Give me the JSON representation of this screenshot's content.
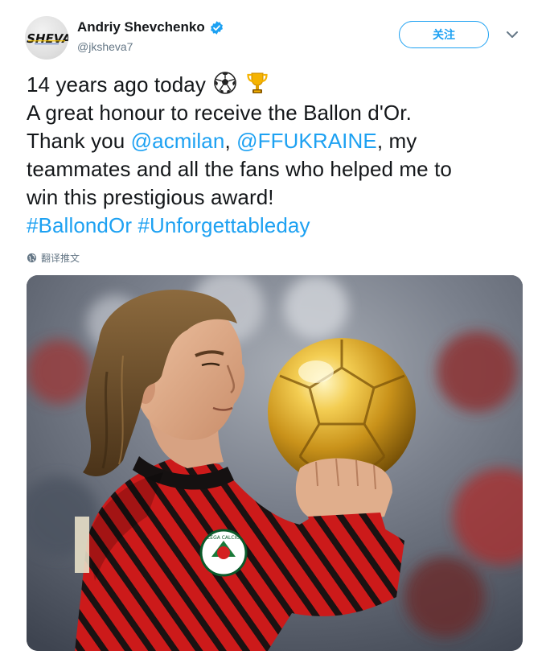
{
  "author": {
    "name": "Andriy Shevchenko",
    "handle": "@jksheva7",
    "avatar_text": "SHEVA",
    "verified_icon": "verified-badge-icon"
  },
  "actions": {
    "follow_label": "关注",
    "menu_icon": "chevron-down-icon"
  },
  "tweet": {
    "line1": "14 years ago today",
    "line2": "A great honour to receive the Ballon d'Or.",
    "line3_pre": "Thank you ",
    "mention1": "@acmilan",
    "line3_mid": ", ",
    "mention2": "@FFUKRAINE",
    "line3_post": ", my",
    "line4": "teammates and all the fans who helped me to",
    "line5": "win this prestigious award!",
    "hashtag1": "#BallondOr",
    "hashtag2": "#Unforgettableday",
    "emojis": [
      "soccer-ball-icon",
      "trophy-icon"
    ]
  },
  "translate": {
    "label": "翻译推文",
    "icon": "globe-icon"
  },
  "media": {
    "type": "photo",
    "subject": "player-holding-golden-ball-image",
    "badge_text": "LEGA CALCIO",
    "colors": {
      "jersey_red": "#c8102e",
      "jersey_black": "#1a1a1a",
      "gold": "#d4a017",
      "background": "#5b6270"
    }
  },
  "colors": {
    "link": "#1da1f2",
    "text": "#14171a",
    "muted": "#657786"
  }
}
